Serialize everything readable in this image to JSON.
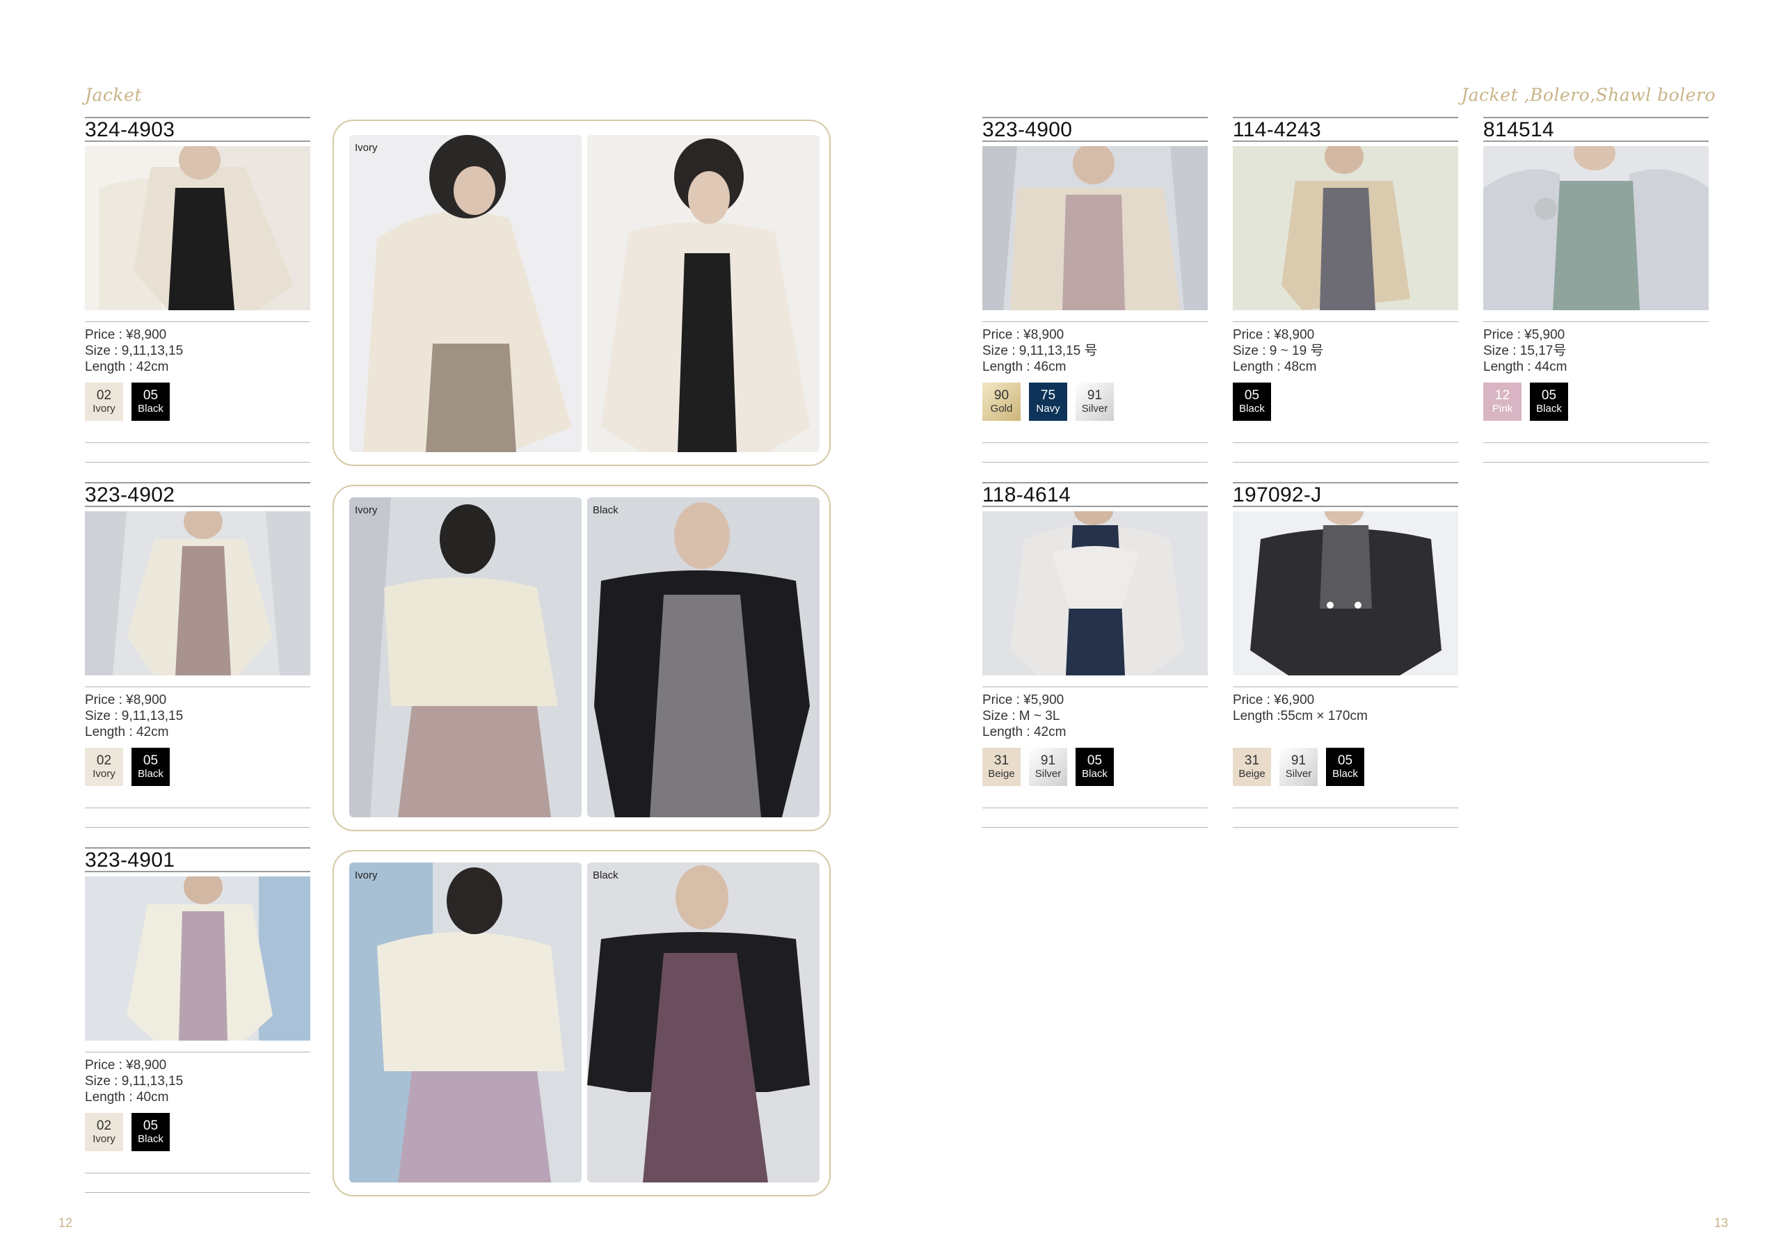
{
  "header": {
    "left_title": "Jacket",
    "right_title": "Jacket ,Bolero,Shawl bolero"
  },
  "page_numbers": {
    "left": "12",
    "right": "13"
  },
  "products": [
    {
      "code": "324-4903",
      "lines": [
        "Price : ¥8,900",
        "Size : 9,11,13,15",
        "Length : 42cm"
      ],
      "swatches": [
        {
          "num": "02",
          "name": "Ivory",
          "bg": "#ede6da",
          "fg": "#333"
        },
        {
          "num": "05",
          "name": "Black",
          "bg": "#000000",
          "fg": "#ffffff"
        }
      ]
    },
    {
      "code": "323-4902",
      "lines": [
        "Price : ¥8,900",
        "Size : 9,11,13,15",
        "Length : 42cm"
      ],
      "swatches": [
        {
          "num": "02",
          "name": "Ivory",
          "bg": "#ede6da",
          "fg": "#333"
        },
        {
          "num": "05",
          "name": "Black",
          "bg": "#000000",
          "fg": "#ffffff"
        }
      ]
    },
    {
      "code": "323-4901",
      "lines": [
        "Price : ¥8,900",
        "Size : 9,11,13,15",
        "Length : 40cm"
      ],
      "swatches": [
        {
          "num": "02",
          "name": "Ivory",
          "bg": "#ede6da",
          "fg": "#333"
        },
        {
          "num": "05",
          "name": "Black",
          "bg": "#000000",
          "fg": "#ffffff"
        }
      ]
    },
    {
      "code": "323-4900",
      "lines": [
        "Price : ¥8,900",
        "Size : 9,11,13,15 号",
        "Length : 46cm"
      ],
      "swatches": [
        {
          "num": "90",
          "name": "Gold",
          "bg": "#d8c99a",
          "fg": "#333"
        },
        {
          "num": "75",
          "name": "Navy",
          "bg": "#0e3358",
          "fg": "#ffffff"
        },
        {
          "num": "91",
          "name": "Silver",
          "bg": "#e9e9ea",
          "fg": "#333"
        }
      ]
    },
    {
      "code": "114-4243",
      "lines": [
        "Price : ¥8,900",
        "Size : 9 ~ 19 号",
        "Length : 48cm"
      ],
      "swatches": [
        {
          "num": "05",
          "name": "Black",
          "bg": "#000000",
          "fg": "#ffffff"
        }
      ]
    },
    {
      "code": "814514",
      "lines": [
        "Price : ¥5,900",
        "Size : 15,17号",
        "Length : 44cm"
      ],
      "swatches": [
        {
          "num": "12",
          "name": "Pink",
          "bg": "#d9b5c3",
          "fg": "#ffffff"
        },
        {
          "num": "05",
          "name": "Black",
          "bg": "#000000",
          "fg": "#ffffff"
        }
      ]
    },
    {
      "code": "118-4614",
      "lines": [
        "Price : ¥5,900",
        "Size : M ~ 3L",
        "Length : 42cm"
      ],
      "swatches": [
        {
          "num": "31",
          "name": "Beige",
          "bg": "#e9dccb",
          "fg": "#333"
        },
        {
          "num": "91",
          "name": "Silver",
          "bg": "#e9e9ea",
          "fg": "#333"
        },
        {
          "num": "05",
          "name": "Black",
          "bg": "#000000",
          "fg": "#ffffff"
        }
      ]
    },
    {
      "code": "197092-J",
      "lines": [
        "Price : ¥6,900",
        "Length :55cm × 170cm"
      ],
      "swatches": [
        {
          "num": "31",
          "name": "Beige",
          "bg": "#e9dccb",
          "fg": "#333"
        },
        {
          "num": "91",
          "name": "Silver",
          "bg": "#e9e9ea",
          "fg": "#333"
        },
        {
          "num": "05",
          "name": "Black",
          "bg": "#000000",
          "fg": "#ffffff"
        }
      ]
    }
  ],
  "panels": [
    {
      "labels": [
        "Ivory",
        ""
      ]
    },
    {
      "labels": [
        "Ivory",
        "Black"
      ]
    },
    {
      "labels": [
        "Ivory",
        "Black"
      ]
    }
  ]
}
